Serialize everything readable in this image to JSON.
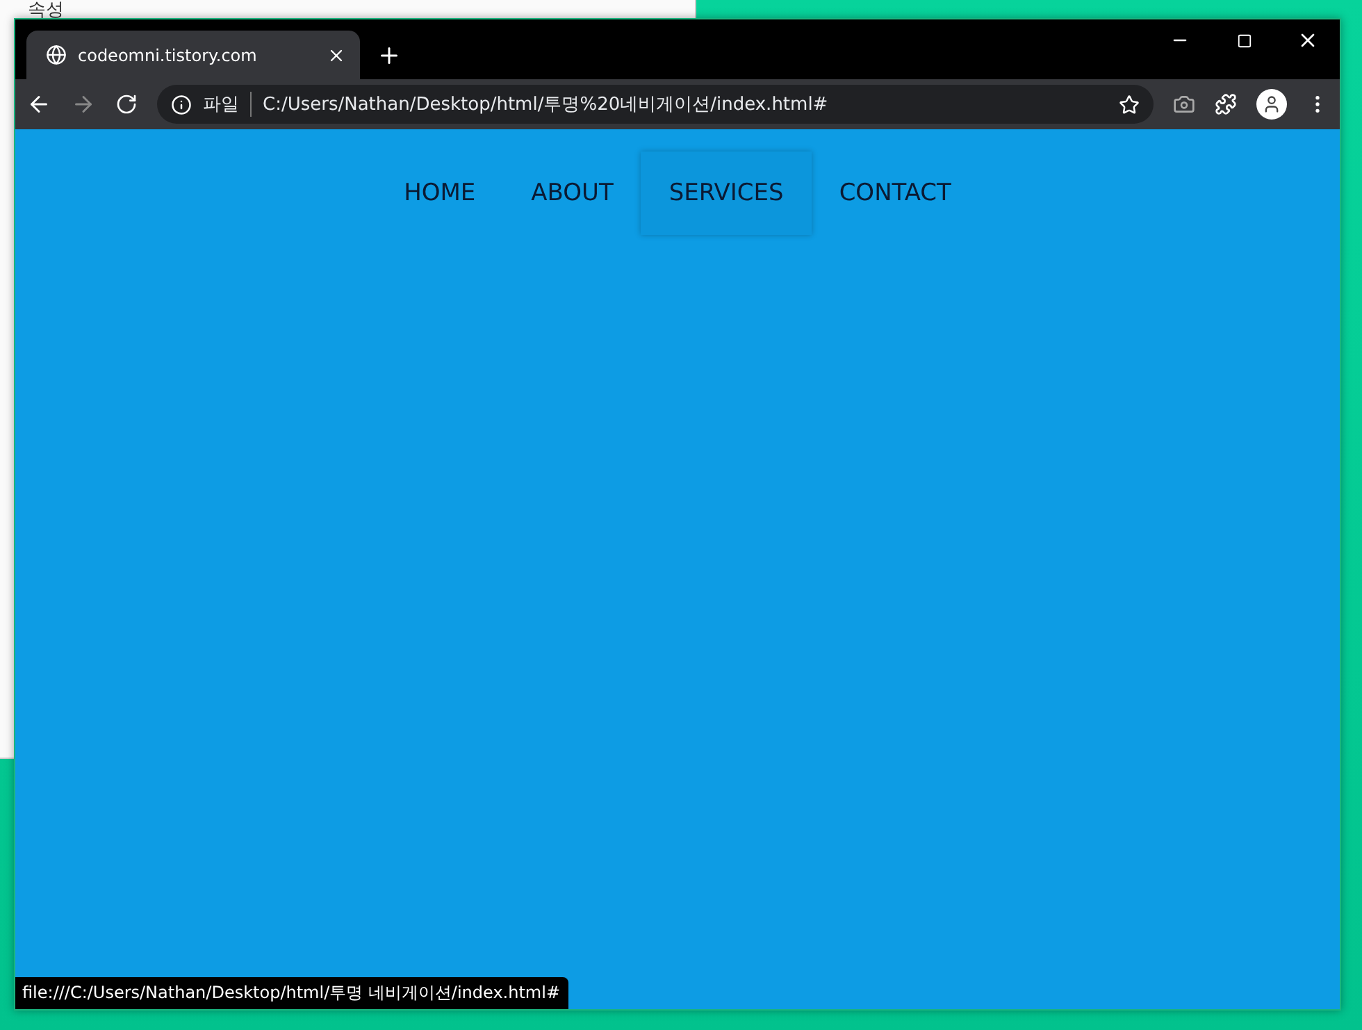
{
  "background_window": {
    "label": "속성"
  },
  "browser": {
    "tab": {
      "title": "codeomni.tistory.com"
    },
    "address_bar": {
      "scheme": "파일",
      "url": "C:/Users/Nathan/Desktop/html/투명%20네비게이션/index.html#"
    },
    "nav": [
      {
        "label": "HOME",
        "selected": false
      },
      {
        "label": "ABOUT",
        "selected": false
      },
      {
        "label": "SERVICES",
        "selected": true
      },
      {
        "label": "CONTACT",
        "selected": false
      }
    ],
    "status_bar": "file:///C:/Users/Nathan/Desktop/html/투명 네비게이션/index.html#"
  }
}
